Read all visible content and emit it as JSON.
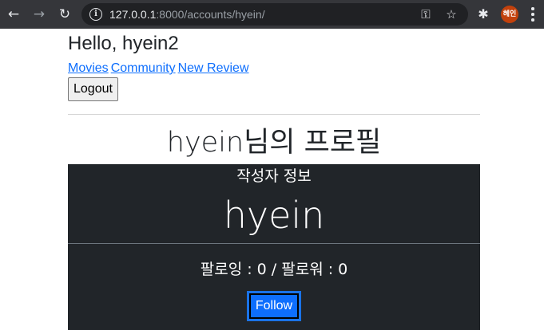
{
  "browser": {
    "url_host": "127.0.0.1",
    "url_rest": ":8000/accounts/hyein/",
    "profile_avatar": "혜인",
    "icons": [
      "back-arrow-icon",
      "forward-arrow-icon",
      "reload-icon",
      "site-info-icon",
      "key-icon",
      "star-icon",
      "puzzle-icon",
      "more-vert-icon"
    ]
  },
  "header": {
    "greeting": "Hello, hyein2",
    "links": [
      "Movies",
      "Community",
      "New Review"
    ],
    "logout_label": "Logout"
  },
  "profile": {
    "title": "hyein님의 프로필",
    "section_label": "작성자 정보",
    "username": "hyein",
    "follow_stats": "팔로잉 : 0 / 팔로워 : 0",
    "follow_button": "Follow"
  },
  "colors": {
    "chrome_bg": "#35363a",
    "card_bg": "#212529",
    "link": "#0d6efd",
    "follow_btn": "#0d6efd"
  }
}
